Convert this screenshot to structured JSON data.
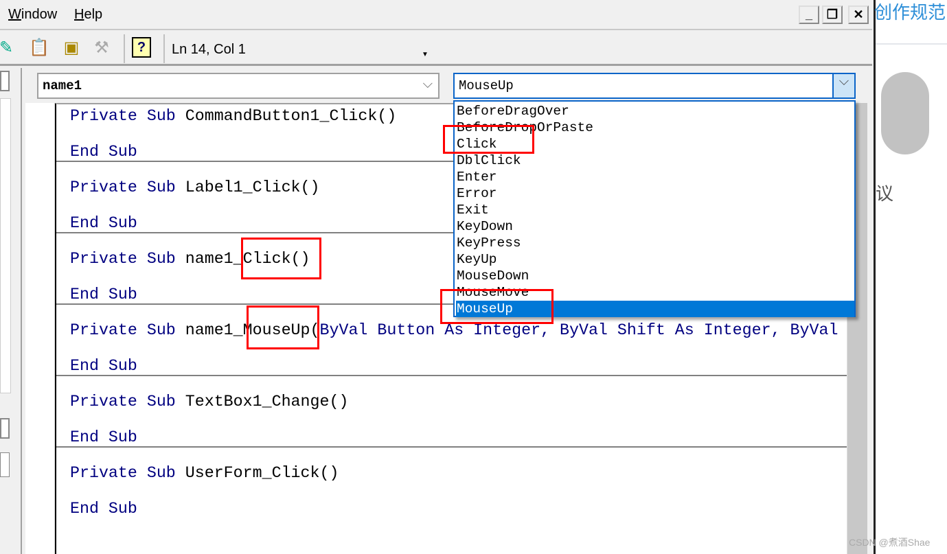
{
  "menubar": {
    "items": [
      {
        "label": "Window",
        "accel": "W",
        "rest": "indow"
      },
      {
        "label": "Help",
        "accel": "H",
        "rest": "elp"
      }
    ]
  },
  "window_controls": {
    "minimize": "_",
    "restore": "❐",
    "close": "✕"
  },
  "toolbar": {
    "icons": [
      "object-browser-icon",
      "properties-icon",
      "toolbox-icon",
      "tools-icon",
      "help-icon"
    ],
    "status": "Ln 14, Col 1"
  },
  "object_combo": {
    "value": "name1"
  },
  "procedure_combo": {
    "value": "MouseUp",
    "options": [
      "BeforeDragOver",
      "BeforeDropOrPaste",
      "Click",
      "DblClick",
      "Enter",
      "Error",
      "Exit",
      "KeyDown",
      "KeyPress",
      "KeyUp",
      "MouseDown",
      "MouseMove",
      "MouseUp"
    ],
    "selected": "MouseUp"
  },
  "code": {
    "procedures": [
      {
        "kw": "Private Sub ",
        "name": "CommandButton1_Click()",
        "params": "",
        "end": "End Sub"
      },
      {
        "kw": "Private Sub ",
        "name": "Label1_Click()",
        "params": "",
        "end": "End Sub"
      },
      {
        "kw": "Private Sub ",
        "name": "name1_Click()",
        "params": "",
        "end": "End Sub"
      },
      {
        "kw": "Private Sub ",
        "name": "name1_MouseUp(",
        "params": "ByVal Button As Integer, ByVal Shift As Integer, ByVal",
        "end": "End Sub"
      },
      {
        "kw": "Private Sub ",
        "name": "TextBox1_Change()",
        "params": "",
        "end": "End Sub"
      },
      {
        "kw": "Private Sub ",
        "name": "UserForm_Click()",
        "params": "",
        "end": "End Sub"
      }
    ]
  },
  "background_page": {
    "heading_fragment": "创作规范",
    "text_fragment": "议",
    "watermark": "CSDN @煮酒Shae"
  },
  "colors": {
    "keyword": "#000080",
    "selection": "#0078d7",
    "highlight_box": "#ff0000",
    "link": "#2e8fd8"
  }
}
